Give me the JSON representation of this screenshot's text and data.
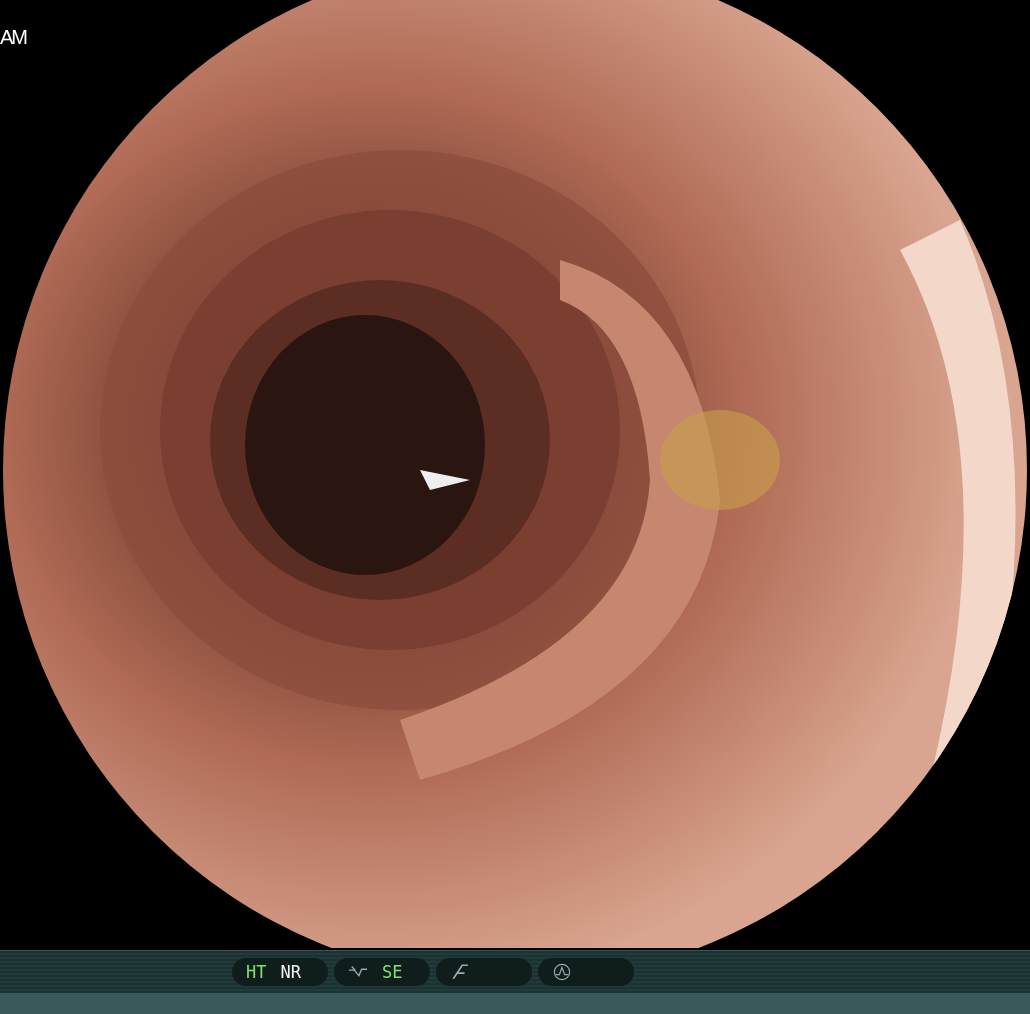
{
  "overlay": {
    "time_text": "AM"
  },
  "status_bar": {
    "groups": [
      {
        "items": [
          {
            "kind": "text",
            "label": "HT",
            "on": true
          },
          {
            "kind": "text",
            "label": "NR",
            "on": false
          }
        ]
      },
      {
        "items": [
          {
            "kind": "tone"
          },
          {
            "kind": "text",
            "label": "SE",
            "on": true
          }
        ]
      },
      {
        "items": [
          {
            "kind": "slash"
          }
        ]
      },
      {
        "items": [
          {
            "kind": "peak"
          }
        ]
      }
    ]
  }
}
